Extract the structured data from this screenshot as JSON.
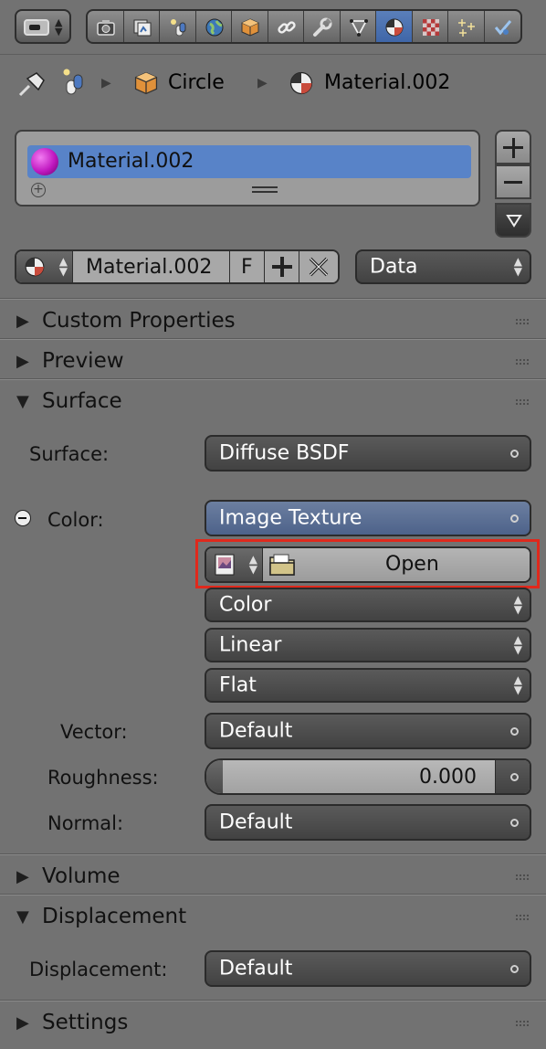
{
  "toolbar": {
    "context_tabs": [
      "render",
      "render-layers",
      "scene",
      "world",
      "object",
      "constraints",
      "modifiers",
      "data",
      "material",
      "texture",
      "particles",
      "physics"
    ],
    "active_tab": "material"
  },
  "breadcrumb": {
    "object": "Circle",
    "material": "Material.002"
  },
  "material_slots": {
    "items": [
      {
        "name": "Material.002",
        "color": "#c21bc2"
      }
    ]
  },
  "datablock": {
    "name": "Material.002",
    "fake_user": "F",
    "link": "Data"
  },
  "panels": {
    "custom_properties": "Custom Properties",
    "preview": "Preview",
    "surface": "Surface",
    "volume": "Volume",
    "displacement": "Displacement",
    "settings": "Settings"
  },
  "surface": {
    "surface_label": "Surface:",
    "surface_value": "Diffuse BSDF",
    "color_label": "Color:",
    "color_value": "Image Texture",
    "open_label": "Open",
    "color_space": "Color",
    "interpolation": "Linear",
    "projection": "Flat",
    "vector_label": "Vector:",
    "vector_value": "Default",
    "roughness_label": "Roughness:",
    "roughness_value": "0.000",
    "normal_label": "Normal:",
    "normal_value": "Default"
  },
  "displacement": {
    "label": "Displacement:",
    "value": "Default"
  },
  "colors": {
    "background": "#727272",
    "selection": "#5883c8",
    "active_node": "#5a6f93",
    "highlight_box": "#e0291c"
  }
}
